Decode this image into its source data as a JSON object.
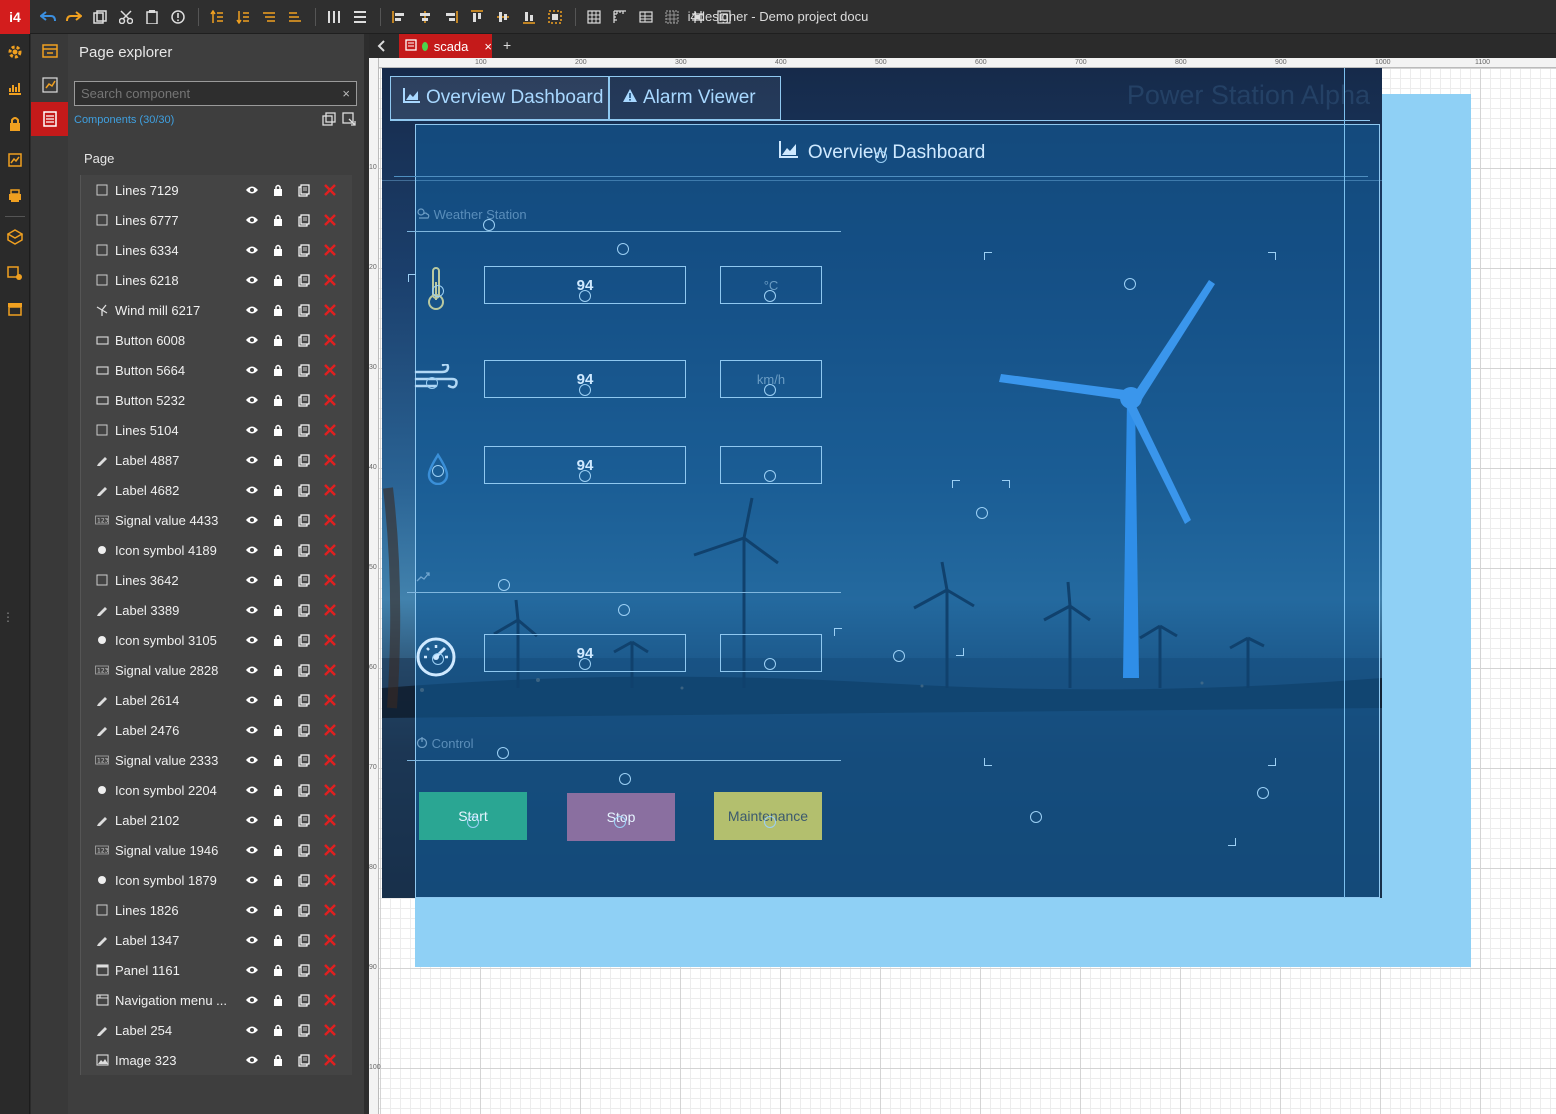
{
  "app": {
    "logo": "i4",
    "title": "i4designer - Demo project docu"
  },
  "toolbar": {
    "icons": [
      "undo-icon",
      "redo-icon",
      "copy-icon",
      "cut-icon",
      "paste-icon",
      "info-icon",
      "bring-front-icon",
      "send-back-icon",
      "forward-icon",
      "backward-icon",
      "distribute-h-icon",
      "distribute-v-icon",
      "align-left-icon",
      "align-center-icon",
      "align-right-icon",
      "align-top-icon",
      "align-middle-icon",
      "align-bottom-icon",
      "group-icon",
      "grid-icon",
      "ruler-icon",
      "table-icon",
      "snap-icon",
      "center-icon",
      "fit-icon"
    ]
  },
  "explorer": {
    "title": "Page explorer",
    "search_placeholder": "Search component",
    "clear_symbol": "×",
    "count": "Components (30/30)",
    "page_label": "Page",
    "items": [
      {
        "label": "Lines 7129",
        "icon": "lines"
      },
      {
        "label": "Lines 6777",
        "icon": "lines"
      },
      {
        "label": "Lines 6334",
        "icon": "lines"
      },
      {
        "label": "Lines 6218",
        "icon": "lines"
      },
      {
        "label": "Wind mill 6217",
        "icon": "windmill"
      },
      {
        "label": "Button 6008",
        "icon": "button"
      },
      {
        "label": "Button 5664",
        "icon": "button"
      },
      {
        "label": "Button 5232",
        "icon": "button"
      },
      {
        "label": "Lines 5104",
        "icon": "lines"
      },
      {
        "label": "Label 4887",
        "icon": "label"
      },
      {
        "label": "Label 4682",
        "icon": "label"
      },
      {
        "label": "Signal value 4433",
        "icon": "signal"
      },
      {
        "label": "Icon symbol 4189",
        "icon": "symbol"
      },
      {
        "label": "Lines 3642",
        "icon": "lines"
      },
      {
        "label": "Label 3389",
        "icon": "label"
      },
      {
        "label": "Icon symbol 3105",
        "icon": "symbol"
      },
      {
        "label": "Signal value 2828",
        "icon": "signal"
      },
      {
        "label": "Label 2614",
        "icon": "label"
      },
      {
        "label": "Label 2476",
        "icon": "label"
      },
      {
        "label": "Signal value 2333",
        "icon": "signal"
      },
      {
        "label": "Icon symbol 2204",
        "icon": "symbol"
      },
      {
        "label": "Label 2102",
        "icon": "label"
      },
      {
        "label": "Signal value 1946",
        "icon": "signal"
      },
      {
        "label": "Icon symbol 1879",
        "icon": "symbol"
      },
      {
        "label": "Lines 1826",
        "icon": "lines"
      },
      {
        "label": "Label 1347",
        "icon": "label"
      },
      {
        "label": "Panel 1161",
        "icon": "panel"
      },
      {
        "label": "Navigation menu ...",
        "icon": "nav"
      },
      {
        "label": "Label 254",
        "icon": "label"
      },
      {
        "label": "Image 323",
        "icon": "image"
      }
    ]
  },
  "tabs": {
    "active": "scada",
    "add": "+",
    "close": "×"
  },
  "ruler": {
    "top": [
      "100",
      "200",
      "300",
      "400",
      "500",
      "600",
      "700",
      "800",
      "900",
      "1000",
      "1100"
    ],
    "left": [
      "10",
      "20",
      "30",
      "40",
      "50",
      "60",
      "70",
      "80",
      "90",
      "100"
    ]
  },
  "scada": {
    "nav": {
      "overview": "Overview Dashboard",
      "alarm": "Alarm Viewer"
    },
    "station_title": "Power Station Alpha",
    "dashboard_title": "Overview Dashboard",
    "weather_label": "Weather Station",
    "control_label": "Control",
    "temperature": {
      "value": "94",
      "unit": "°C"
    },
    "wind": {
      "value": "94",
      "unit": "km/h"
    },
    "humidity": {
      "value": "94",
      "unit": ""
    },
    "rotor": {
      "value": "94",
      "unit": ""
    },
    "buttons": {
      "start": "Start",
      "stop": "Stop",
      "maintenance": "Maintenance"
    }
  },
  "colors": {
    "accent": "#c41a1a",
    "selection": "#8fd0f5",
    "start": "#2aa693",
    "stop": "#8a6fa0",
    "maintenance": "#b3bf6e",
    "link": "#3fa0e0"
  }
}
